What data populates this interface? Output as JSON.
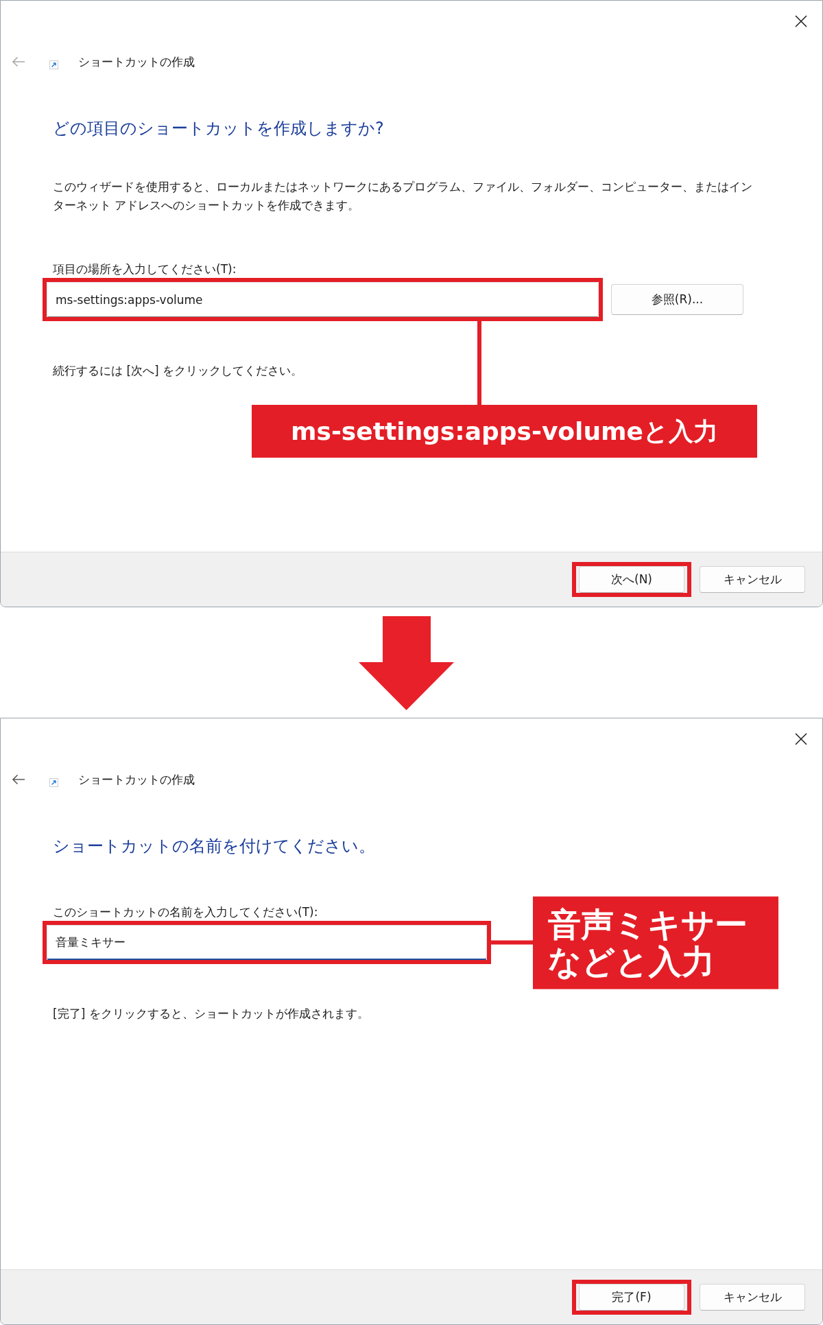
{
  "panels": [
    {
      "window": {
        "title": "ショートカットの作成",
        "back_enabled": false
      },
      "heading": "どの項目のショートカットを作成しますか?",
      "description": "このウィザードを使用すると、ローカルまたはネットワークにあるプログラム、ファイル、フォルダー、コンピューター、またはインターネット アドレスへのショートカットを作成できます。",
      "field": {
        "label": "項目の場所を入力してください(T):",
        "value": "ms-settings:apps-volume",
        "highlighted": true,
        "focused": false
      },
      "browse_button": {
        "label": "参照(R)..."
      },
      "instruction": "続行するには [次へ] をクリックしてください。",
      "callout": {
        "kind": "below",
        "lines": [
          "ms-settings:apps-volumeと入力"
        ]
      },
      "buttons": [
        {
          "label": "次へ(N)",
          "highlighted": true
        },
        {
          "label": "キャンセル",
          "highlighted": false
        }
      ]
    },
    {
      "window": {
        "title": "ショートカットの作成",
        "back_enabled": true
      },
      "heading": "ショートカットの名前を付けてください。",
      "field": {
        "label": "このショートカットの名前を入力してください(T):",
        "value": "音量ミキサー",
        "highlighted": true,
        "focused": true
      },
      "instruction": "[完了] をクリックすると、ショートカットが作成されます。",
      "callout": {
        "kind": "right",
        "lines": [
          "音声ミキサー",
          "などと入力"
        ]
      },
      "buttons": [
        {
          "label": "完了(F)",
          "highlighted": true
        },
        {
          "label": "キャンセル",
          "highlighted": false
        }
      ]
    }
  ]
}
